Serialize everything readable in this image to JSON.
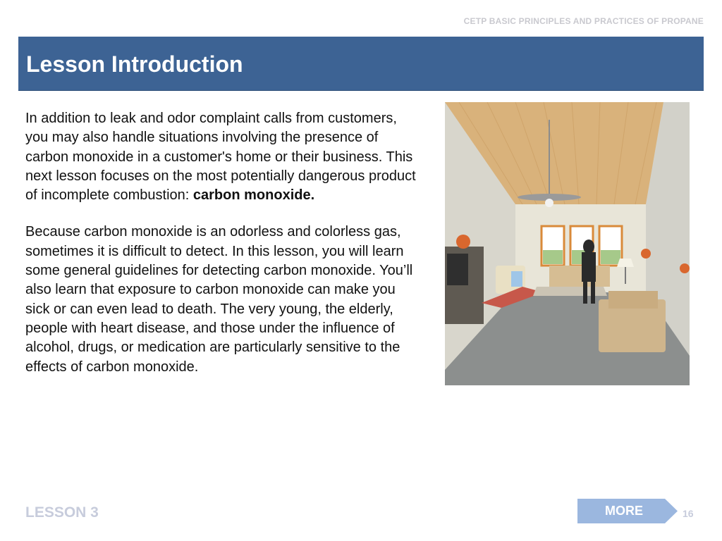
{
  "header": {
    "course_title": "CETP BASIC PRINCIPLES AND PRACTICES OF PROPANE",
    "slide_title": "Lesson Introduction"
  },
  "content": {
    "paragraph1_text": "In addition to leak and odor complaint calls from customers, you may also handle situations involving the presence of carbon monoxide in a customer's home or their business. This next lesson focuses on the most potentially dangerous product of incomplete combustion: ",
    "paragraph1_emphasis": "carbon monoxide.",
    "paragraph2_text": "Because carbon monoxide is an odorless and colorless gas, sometimes it is difficult to detect. In this lesson, you will learn some general guidelines for detecting carbon monoxide. You’ll also learn that exposure to carbon monoxide can make you sick or can even lead to death. The very young, the elderly, people with heart disease, and those under the influence of alcohol, drugs, or medication are particularly sensitive to the effects of carbon monoxide."
  },
  "footer": {
    "lesson_label": "LESSON 3",
    "more_label": "MORE",
    "page_number": "16"
  },
  "colors": {
    "title_bar": "#3d6394",
    "more_button": "#9bb7df",
    "footer_text": "#c7ccdc",
    "course_title": "#c9c9cf"
  },
  "icons": {
    "illustration": "living-room-illustration"
  }
}
